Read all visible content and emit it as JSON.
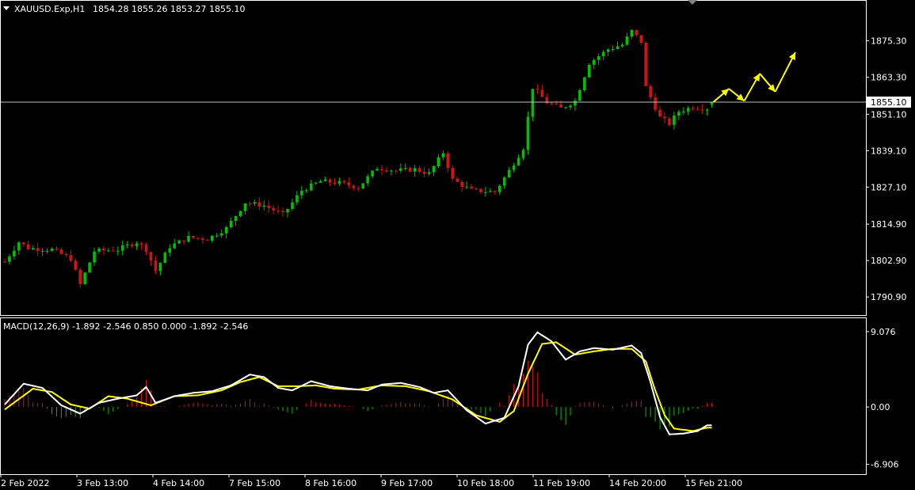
{
  "header": {
    "symbol": "XAUUSD.Exp,H1",
    "ohlc": "1854.28 1855.26 1853.27 1855.10"
  },
  "price_panel": {
    "y_ticks": [
      "1875.30",
      "1863.30",
      "1851.10",
      "1839.10",
      "1827.10",
      "1814.90",
      "1802.90",
      "1790.90"
    ],
    "current_price": "1855.10"
  },
  "macd_panel": {
    "label": "MACD(12,26,9) -1.892 -2.546 0.850 0.000 -1.892 -2.546",
    "y_ticks": [
      "9.076",
      "0.00",
      "-6.906"
    ]
  },
  "x_axis": {
    "labels": [
      "2 Feb 2022",
      "3 Feb 13:00",
      "4 Feb 14:00",
      "7 Feb 15:00",
      "8 Feb 16:00",
      "9 Feb 17:00",
      "10 Feb 18:00",
      "11 Feb 19:00",
      "14 Feb 20:00",
      "15 Feb 21:00"
    ]
  },
  "colors": {
    "background": "#000000",
    "bull": "#00c000",
    "bear": "#d01414",
    "macd_line": "#ffffff",
    "signal_line": "#ffff00",
    "arrow": "#ffff00",
    "price_line": "#c0c0c0",
    "grid_border": "#ffffff"
  },
  "chart_data": [
    {
      "type": "candlestick",
      "title": "XAUUSD.Exp,H1",
      "timeframe": "H1",
      "ylim": [
        1786.5,
        1883.0
      ],
      "last": {
        "open": 1854.28,
        "high": 1855.26,
        "low": 1853.27,
        "close": 1855.1
      },
      "close_path": [
        [
          0,
          1802.5
        ],
        [
          3,
          1809.0
        ],
        [
          5,
          1807.0
        ],
        [
          10,
          1806.5
        ],
        [
          14,
          1803.5
        ],
        [
          16,
          1795.0
        ],
        [
          19,
          1806.0
        ],
        [
          24,
          1806.5
        ],
        [
          28,
          1809.0
        ],
        [
          30,
          1806.5
        ],
        [
          32,
          1799.5
        ],
        [
          35,
          1807.5
        ],
        [
          39,
          1810.5
        ],
        [
          43,
          1810.0
        ],
        [
          47,
          1813.5
        ],
        [
          51,
          1822.0
        ],
        [
          55,
          1821.0
        ],
        [
          59,
          1818.0
        ],
        [
          63,
          1826.0
        ],
        [
          67,
          1829.0
        ],
        [
          71,
          1828.5
        ],
        [
          75,
          1827.0
        ],
        [
          79,
          1833.5
        ],
        [
          83,
          1832.5
        ],
        [
          87,
          1833.0
        ],
        [
          90,
          1831.5
        ],
        [
          93,
          1838.5
        ],
        [
          95,
          1829.5
        ],
        [
          99,
          1826.0
        ],
        [
          104,
          1825.5
        ],
        [
          107,
          1832.5
        ],
        [
          110,
          1840.0
        ],
        [
          112,
          1860.0
        ],
        [
          115,
          1855.0
        ],
        [
          118,
          1853.0
        ],
        [
          121,
          1855.5
        ],
        [
          124,
          1868.0
        ],
        [
          128,
          1872.5
        ],
        [
          131,
          1874.0
        ],
        [
          133,
          1878.5
        ],
        [
          135,
          1875.0
        ],
        [
          136,
          1860.0
        ],
        [
          139,
          1850.0
        ],
        [
          141,
          1848.0
        ],
        [
          143,
          1852.0
        ],
        [
          146,
          1853.5
        ],
        [
          149,
          1853.0
        ],
        [
          150,
          1855.1
        ]
      ],
      "forecast_arrows": [
        [
          1855.1,
          1859.5
        ],
        [
          1859.5,
          1855.5
        ],
        [
          1855.5,
          1864.5
        ],
        [
          1864.5,
          1858.5
        ],
        [
          1858.5,
          1871.5
        ]
      ],
      "y_ticks": [
        1875.3,
        1863.3,
        1851.1,
        1839.1,
        1827.1,
        1814.9,
        1802.9,
        1790.9
      ],
      "x_tick_labels": [
        "2 Feb 2022",
        "3 Feb 13:00",
        "4 Feb 14:00",
        "7 Feb 15:00",
        "8 Feb 16:00",
        "9 Feb 17:00",
        "10 Feb 18:00",
        "11 Feb 19:00",
        "14 Feb 20:00",
        "15 Feb 21:00"
      ]
    },
    {
      "type": "line",
      "title": "MACD(12,26,9)",
      "ylim": [
        -8.0,
        10.5
      ],
      "y_ticks": [
        9.076,
        0.0,
        -6.906
      ],
      "series": [
        {
          "name": "MACD",
          "points": [
            [
              0,
              0.3
            ],
            [
              4,
              2.8
            ],
            [
              8,
              2.3
            ],
            [
              12,
              0.2
            ],
            [
              16,
              -0.8
            ],
            [
              20,
              0.5
            ],
            [
              24,
              1.0
            ],
            [
              28,
              1.4
            ],
            [
              30,
              2.4
            ],
            [
              32,
              0.5
            ],
            [
              36,
              1.3
            ],
            [
              40,
              1.7
            ],
            [
              44,
              1.9
            ],
            [
              48,
              2.6
            ],
            [
              52,
              3.9
            ],
            [
              55,
              3.6
            ],
            [
              58,
              2.3
            ],
            [
              61,
              2.0
            ],
            [
              65,
              3.1
            ],
            [
              69,
              2.5
            ],
            [
              73,
              2.2
            ],
            [
              77,
              2.0
            ],
            [
              80,
              2.7
            ],
            [
              84,
              2.9
            ],
            [
              88,
              2.4
            ],
            [
              91,
              1.7
            ],
            [
              94,
              2.0
            ],
            [
              98,
              -0.4
            ],
            [
              102,
              -2.0
            ],
            [
              106,
              -1.3
            ],
            [
              109,
              2.5
            ],
            [
              111,
              7.5
            ],
            [
              113,
              9.0
            ],
            [
              116,
              7.9
            ],
            [
              119,
              5.7
            ],
            [
              122,
              6.7
            ],
            [
              125,
              7.1
            ],
            [
              129,
              6.9
            ],
            [
              133,
              7.4
            ],
            [
              135,
              6.5
            ],
            [
              137,
              3.0
            ],
            [
              139,
              -1.2
            ],
            [
              141,
              -3.3
            ],
            [
              144,
              -3.2
            ],
            [
              147,
              -2.9
            ],
            [
              149,
              -2.2
            ]
          ]
        },
        {
          "name": "Signal",
          "points": [
            [
              0,
              -0.3
            ],
            [
              6,
              2.2
            ],
            [
              10,
              1.8
            ],
            [
              14,
              0.3
            ],
            [
              18,
              -0.2
            ],
            [
              22,
              1.3
            ],
            [
              26,
              1.0
            ],
            [
              31,
              0.2
            ],
            [
              36,
              1.3
            ],
            [
              41,
              1.4
            ],
            [
              46,
              2.0
            ],
            [
              50,
              3.0
            ],
            [
              54,
              3.6
            ],
            [
              58,
              2.5
            ],
            [
              62,
              2.5
            ],
            [
              66,
              2.6
            ],
            [
              70,
              2.2
            ],
            [
              75,
              2.1
            ],
            [
              80,
              2.6
            ],
            [
              85,
              2.5
            ],
            [
              90,
              1.9
            ],
            [
              95,
              0.9
            ],
            [
              100,
              -1.0
            ],
            [
              105,
              -1.8
            ],
            [
              108,
              -0.5
            ],
            [
              111,
              4.0
            ],
            [
              114,
              7.6
            ],
            [
              117,
              7.8
            ],
            [
              121,
              6.3
            ],
            [
              125,
              6.7
            ],
            [
              129,
              7.0
            ],
            [
              133,
              7.0
            ],
            [
              136,
              5.5
            ],
            [
              138,
              2.0
            ],
            [
              140,
              -1.0
            ],
            [
              142,
              -2.6
            ],
            [
              146,
              -2.9
            ],
            [
              149,
              -2.5
            ]
          ]
        }
      ],
      "histogram_note": "OsMA bars = MACD - Signal"
    }
  ]
}
